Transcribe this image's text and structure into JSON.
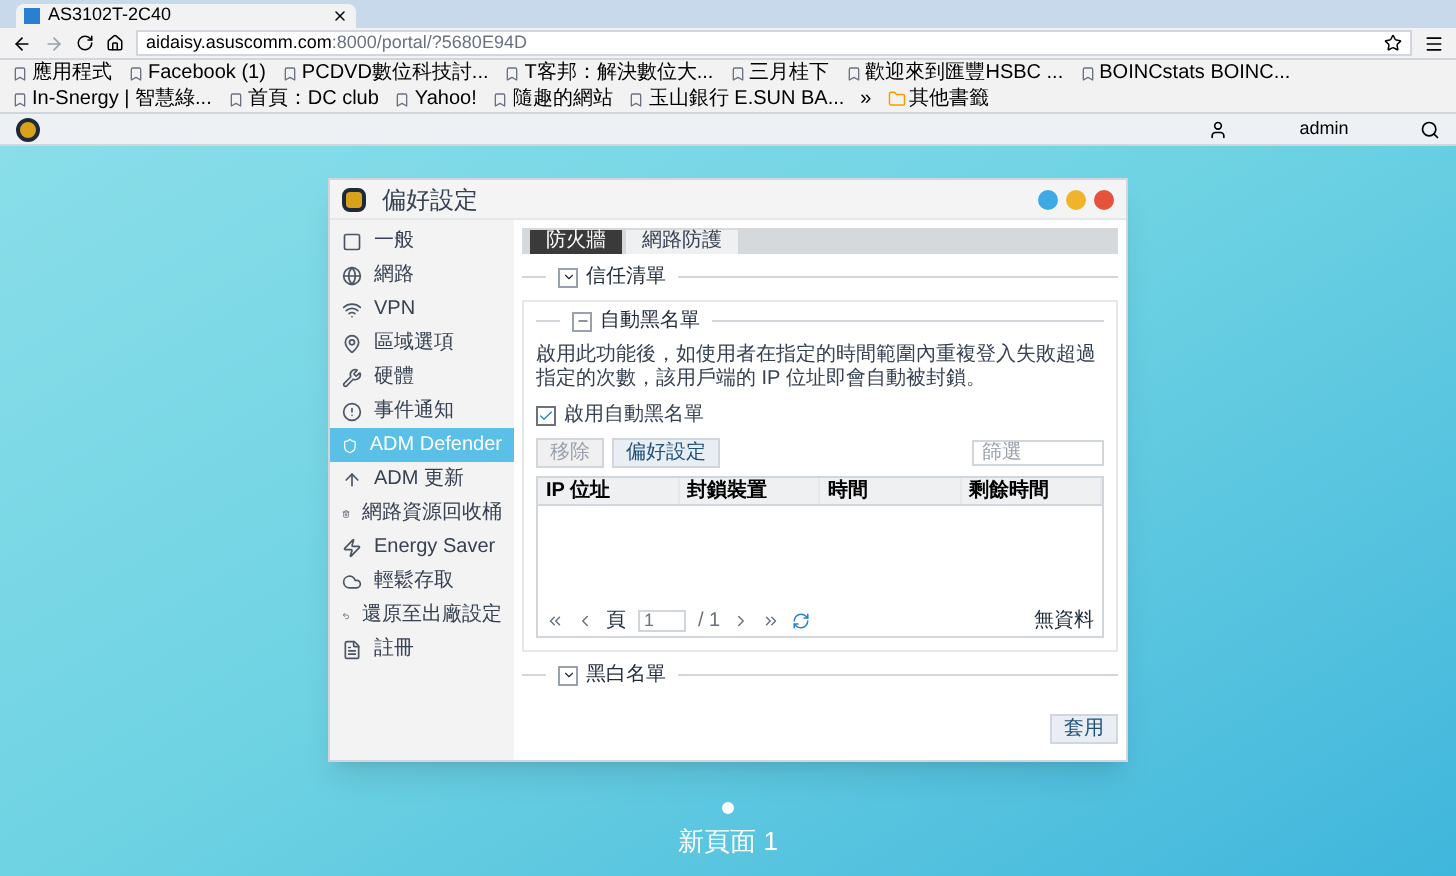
{
  "browser": {
    "tab_title": "AS3102T-2C40",
    "url_host": "aidaisy.asuscomm.com",
    "url_path": ":8000/portal/?5680E94D",
    "bookmarks": [
      "應用程式",
      "Facebook (1)",
      "PCDVD數位科技討...",
      "T客邦：解決數位大...",
      "三月桂下",
      "歡迎來到匯豐HSBC ...",
      "BOINCstats BOINC...",
      "In-Snergy | 智慧綠...",
      "首頁：DC club",
      "Yahoo!",
      "隨趣的網站",
      "玉山銀行 E.SUN BA..."
    ],
    "more": "»",
    "other_bookmarks": "其他書籤"
  },
  "app_bar": {
    "user": "admin"
  },
  "dialog": {
    "title": "偏好設定",
    "sidebar": [
      {
        "label": "一般",
        "selected": false
      },
      {
        "label": "網路",
        "selected": false
      },
      {
        "label": "VPN",
        "selected": false
      },
      {
        "label": "區域選項",
        "selected": false
      },
      {
        "label": "硬體",
        "selected": false
      },
      {
        "label": "事件通知",
        "selected": false
      },
      {
        "label": "ADM Defender",
        "selected": true
      },
      {
        "label": "ADM 更新",
        "selected": false
      },
      {
        "label": "網路資源回收桶",
        "selected": false
      },
      {
        "label": "Energy Saver",
        "selected": false
      },
      {
        "label": "輕鬆存取",
        "selected": false
      },
      {
        "label": "還原至出廠設定",
        "selected": false
      },
      {
        "label": "註冊",
        "selected": false
      }
    ],
    "tabs": [
      {
        "label": "防火牆",
        "selected": true
      },
      {
        "label": "網路防護",
        "selected": false
      }
    ],
    "sections": [
      {
        "title": "信任清單",
        "expanded": false
      },
      {
        "title": "自動黑名單",
        "expanded": true
      },
      {
        "title": "黑白名單",
        "expanded": false
      }
    ],
    "description": "啟用此功能後，如使用者在指定的時間範圍內重複登入失敗超過指定的次數，該用戶端的 IP 位址即會自動被封鎖。",
    "enable": {
      "label": "啟用自動黑名單",
      "checked": true
    },
    "buttons": [
      {
        "label": "移除",
        "disabled": true
      },
      {
        "label": "偏好設定",
        "disabled": false
      }
    ],
    "filter_placeholder": "篩選",
    "columns": [
      "IP 位址",
      "封鎖裝置",
      "時間",
      "剩餘時間"
    ],
    "pager": {
      "page_label": "頁",
      "page": "1",
      "total": "/ 1",
      "empty": "無資料"
    },
    "apply": "套用"
  },
  "desktop": {
    "page_label": "新頁面 1"
  }
}
